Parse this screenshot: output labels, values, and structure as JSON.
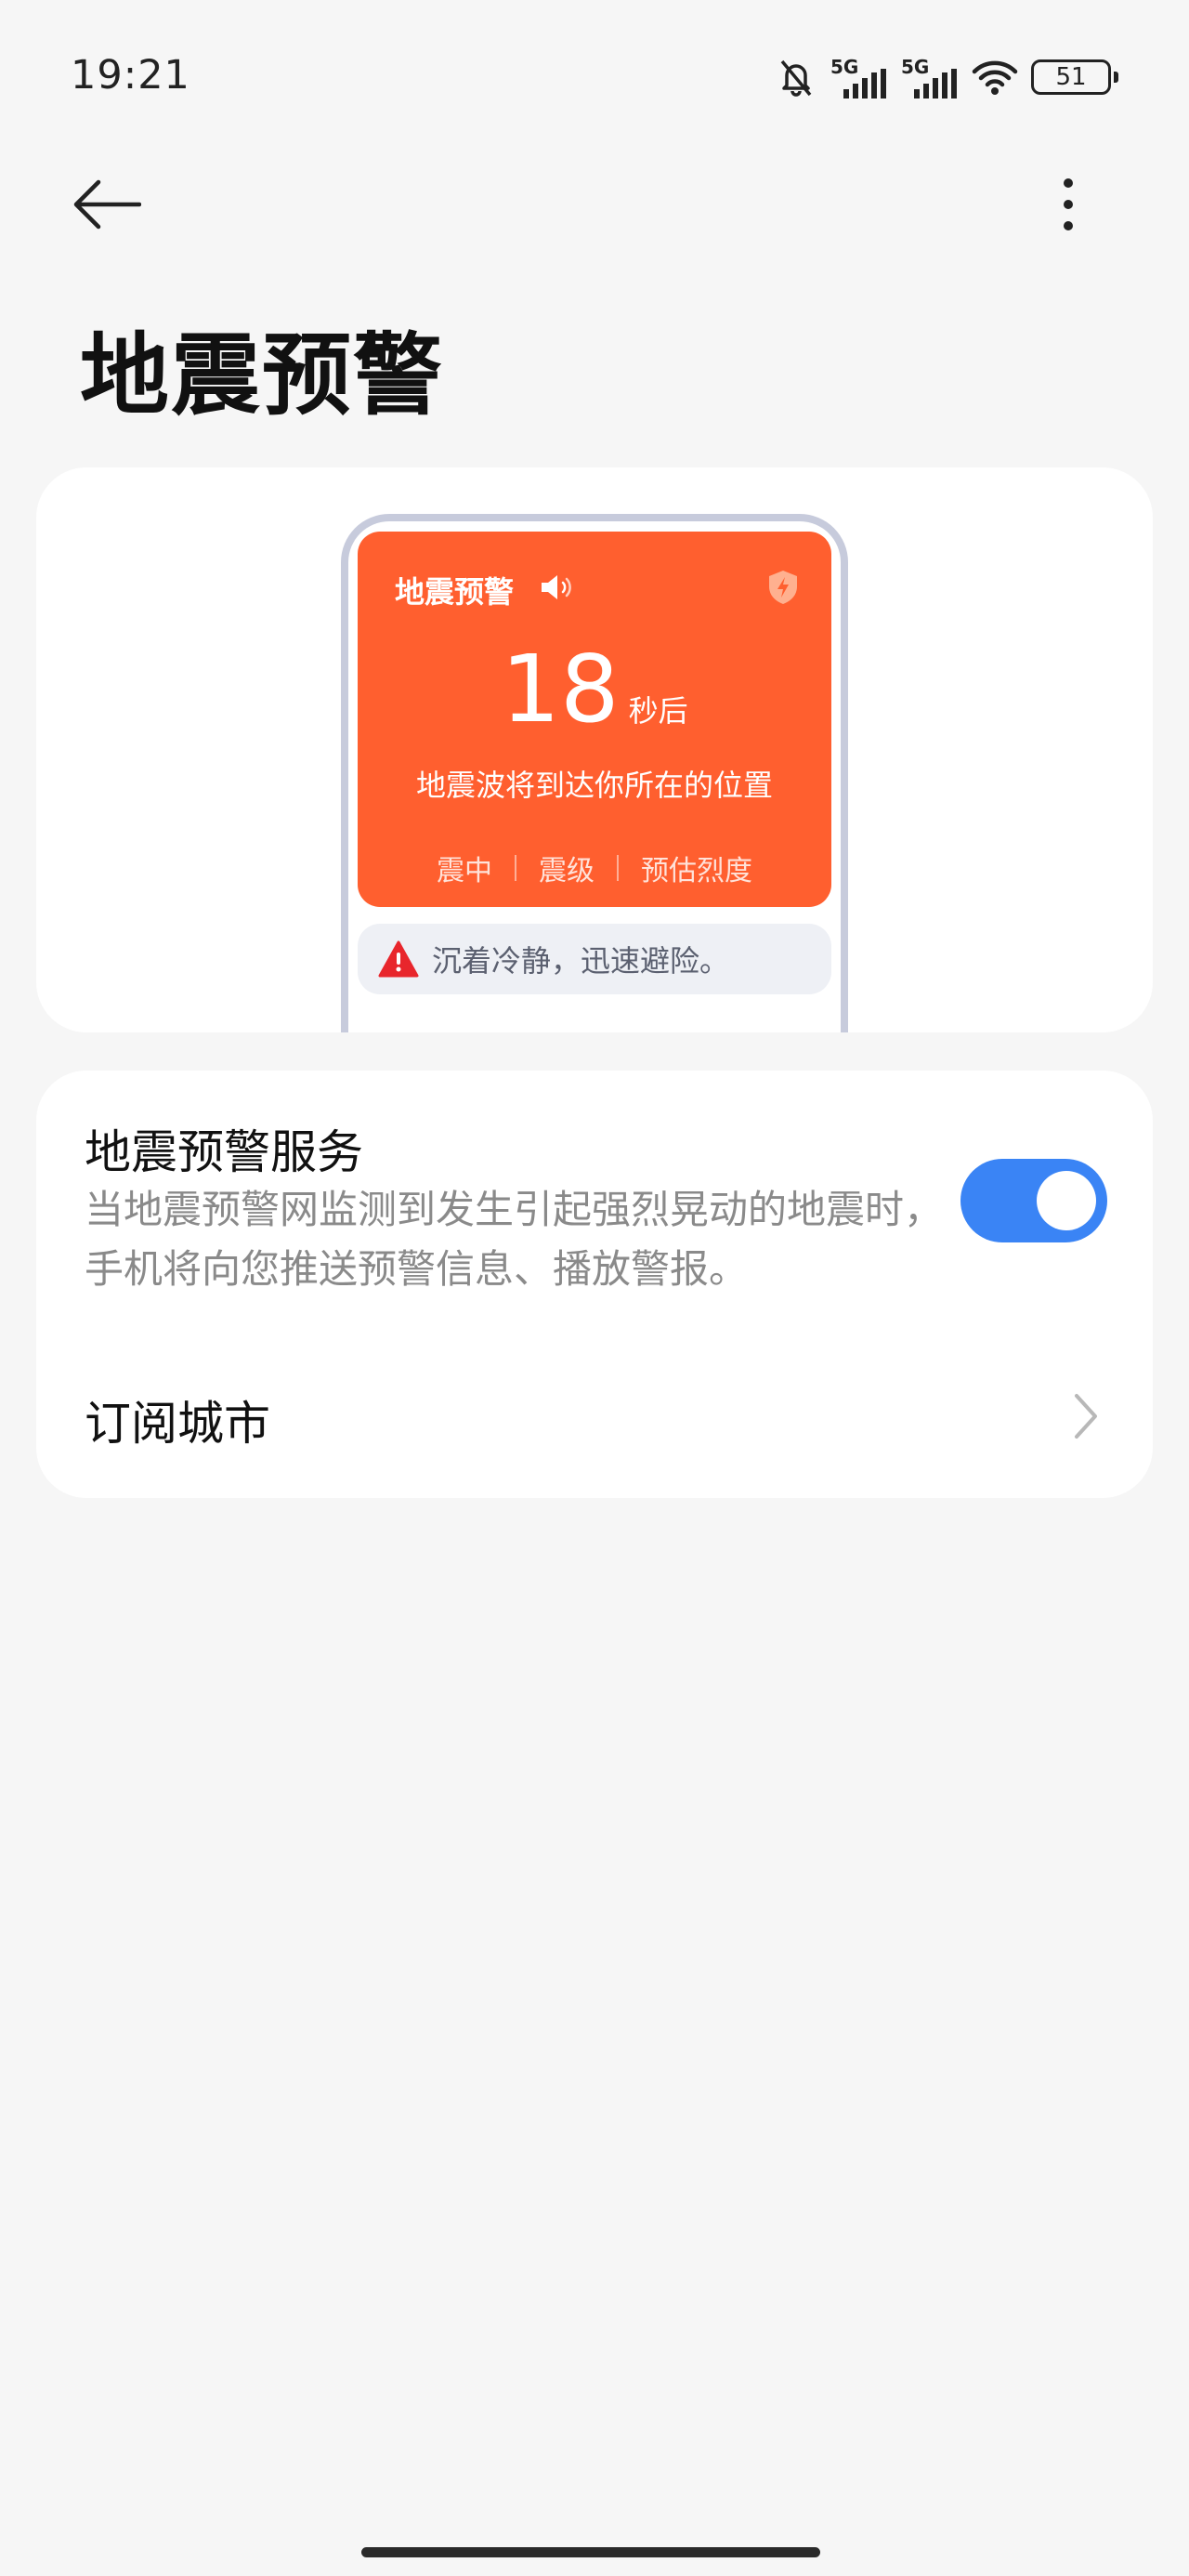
{
  "status_bar": {
    "time": "19:21",
    "network_1": "5G",
    "network_2": "5G",
    "battery_level": "51"
  },
  "header": {
    "title": "地震预警"
  },
  "illustration": {
    "alert_title": "地震预警",
    "countdown_number": "18",
    "countdown_unit": "秒后",
    "subtitle": "地震波将到达你所在的位置",
    "info": [
      "震中",
      "震级",
      "预估烈度"
    ],
    "tip": "沉着冷静，迅速避险。",
    "accent_color": "#ff5f2f"
  },
  "settings": {
    "service_title": "地震预警服务",
    "service_description": "当地震预警网监测到发生引起强烈晃动的地震时，手机将向您推送预警信息、播放警报。",
    "service_enabled": true,
    "toggle_color": "#3a84f5",
    "subscribe_city_label": "订阅城市"
  }
}
